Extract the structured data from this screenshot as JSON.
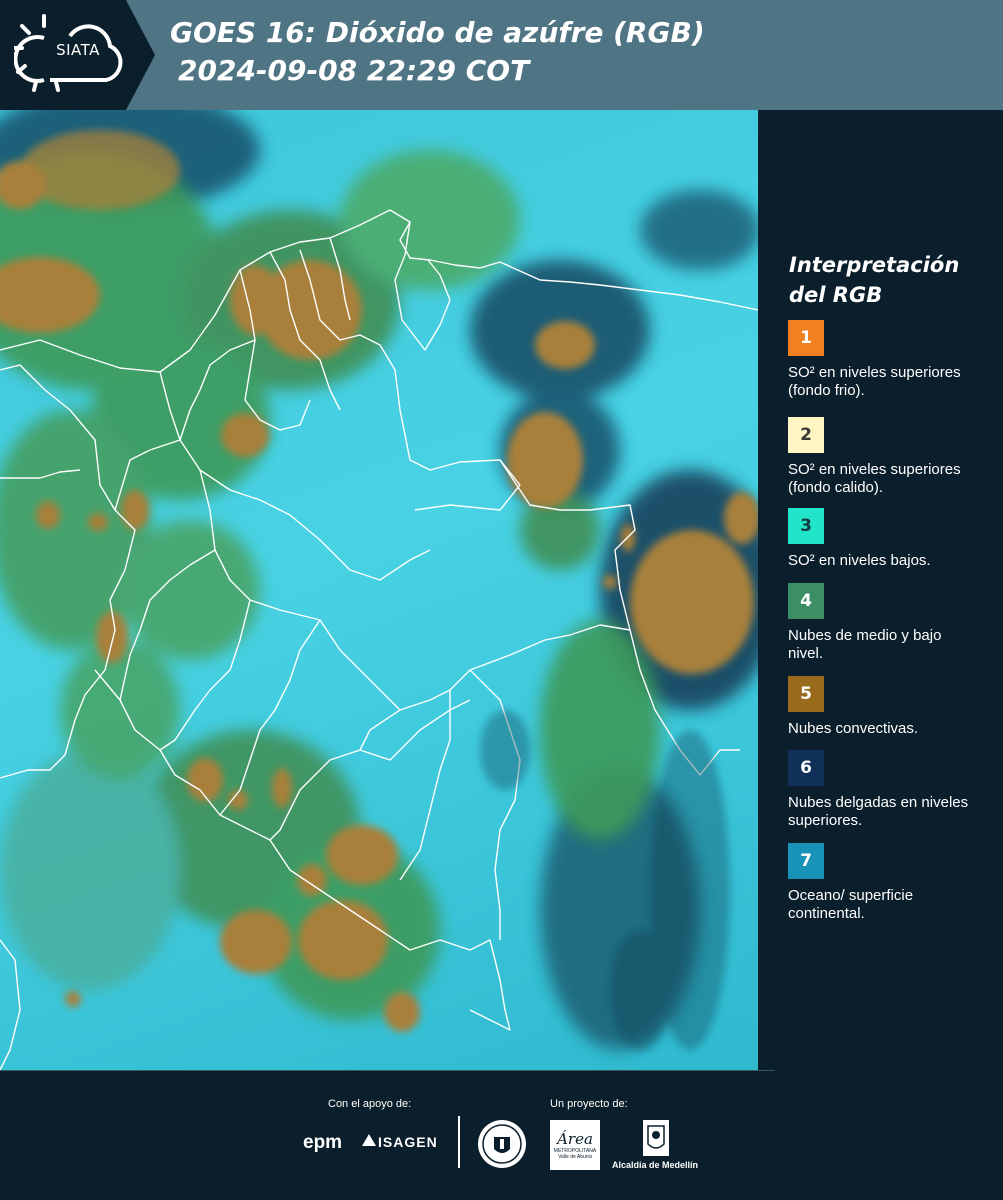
{
  "header": {
    "logo_text": "SIATA",
    "title_line1": "GOES 16: Dióxido de azúfre (RGB)",
    "title_line2": "2024-09-08 22:29 COT"
  },
  "map": {
    "colors": {
      "ocean_surface": "#3ec6da",
      "medium_low_cloud": "#3d9a5a",
      "convective_cloud": "#a8803a",
      "thin_high_cloud": "#123a55",
      "border_lines": "#ffffff"
    }
  },
  "legend": {
    "title": "Interpretación del RGB",
    "items": [
      {
        "number": "1",
        "color": "#f08020",
        "label": "SO² en niveles superiores (fondo frio)."
      },
      {
        "number": "2",
        "color": "#fff6c4",
        "label": "SO² en niveles superiores (fondo calido)."
      },
      {
        "number": "3",
        "color": "#22e4c8",
        "label": "SO² en niveles bajos."
      },
      {
        "number": "4",
        "color": "#3c8f64",
        "label": "Nubes de medio y bajo nivel."
      },
      {
        "number": "5",
        "color": "#9a6a1c",
        "label": "Nubes convectivas."
      },
      {
        "number": "6",
        "color": "#10305a",
        "label": "Nubes delgadas en niveles superiores."
      },
      {
        "number": "7",
        "color": "#1992b8",
        "label": "Oceano/ superficie continental."
      }
    ]
  },
  "footer": {
    "support_label": "Con el apoyo de:",
    "project_label": "Un proyecto de:",
    "sponsors": [
      "epm",
      "ISAGEN"
    ],
    "area_logo": "Área",
    "area_logo_sub": "METROPOLITANA Valle de Aburrá",
    "alcaldia_label": "Alcaldía de Medellín"
  }
}
